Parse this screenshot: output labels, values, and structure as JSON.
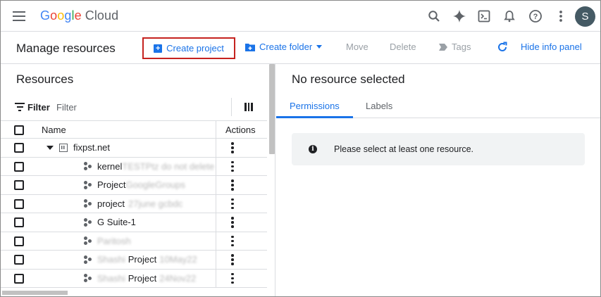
{
  "app": {
    "logo_google": [
      "G",
      "o",
      "o",
      "g",
      "l",
      "e"
    ],
    "logo_product": "Cloud",
    "avatar_initial": "S",
    "icons": [
      "menu-icon",
      "search-icon",
      "gemini-icon",
      "terminal-icon",
      "bell-icon",
      "help-icon",
      "more-vert-icon"
    ]
  },
  "toolbar": {
    "title": "Manage resources",
    "create_project": "Create project",
    "create_folder": "Create folder",
    "move": "Move",
    "delete": "Delete",
    "tags": "Tags",
    "hide_info_panel": "Hide info panel"
  },
  "resources": {
    "title": "Resources",
    "filter_label": "Filter",
    "filter_placeholder": "Filter",
    "columns": {
      "name": "Name",
      "actions": "Actions"
    },
    "rows": [
      {
        "name": "fixpst.net",
        "hidden_suffix": "",
        "type": "organization"
      },
      {
        "name": "kernel",
        "hidden_suffix": "TESTPtz do not delete",
        "type": "project"
      },
      {
        "name": "Project",
        "hidden_suffix": "GoogleGroups",
        "type": "project"
      },
      {
        "name": "project",
        "hidden_suffix": "27june gcbdc",
        "type": "project"
      },
      {
        "name": "G Suite-1",
        "hidden_suffix": "",
        "type": "project"
      },
      {
        "name": "",
        "hidden_suffix": "Paritosh",
        "type": "project"
      },
      {
        "name": "Project",
        "hidden_prefix": "Shashi",
        "hidden_suffix": "10May22",
        "type": "project"
      },
      {
        "name": "Project",
        "hidden_prefix": "Shashi",
        "hidden_suffix": "24Nov22",
        "type": "project"
      }
    ]
  },
  "info_panel": {
    "title": "No resource selected",
    "tabs": [
      "Permissions",
      "Labels"
    ],
    "active_tab": "Permissions",
    "message": "Please select at least one resource."
  },
  "colors": {
    "accent": "#1a73e8",
    "highlight_border": "#c5221f",
    "avatar_bg": "#455a64"
  }
}
